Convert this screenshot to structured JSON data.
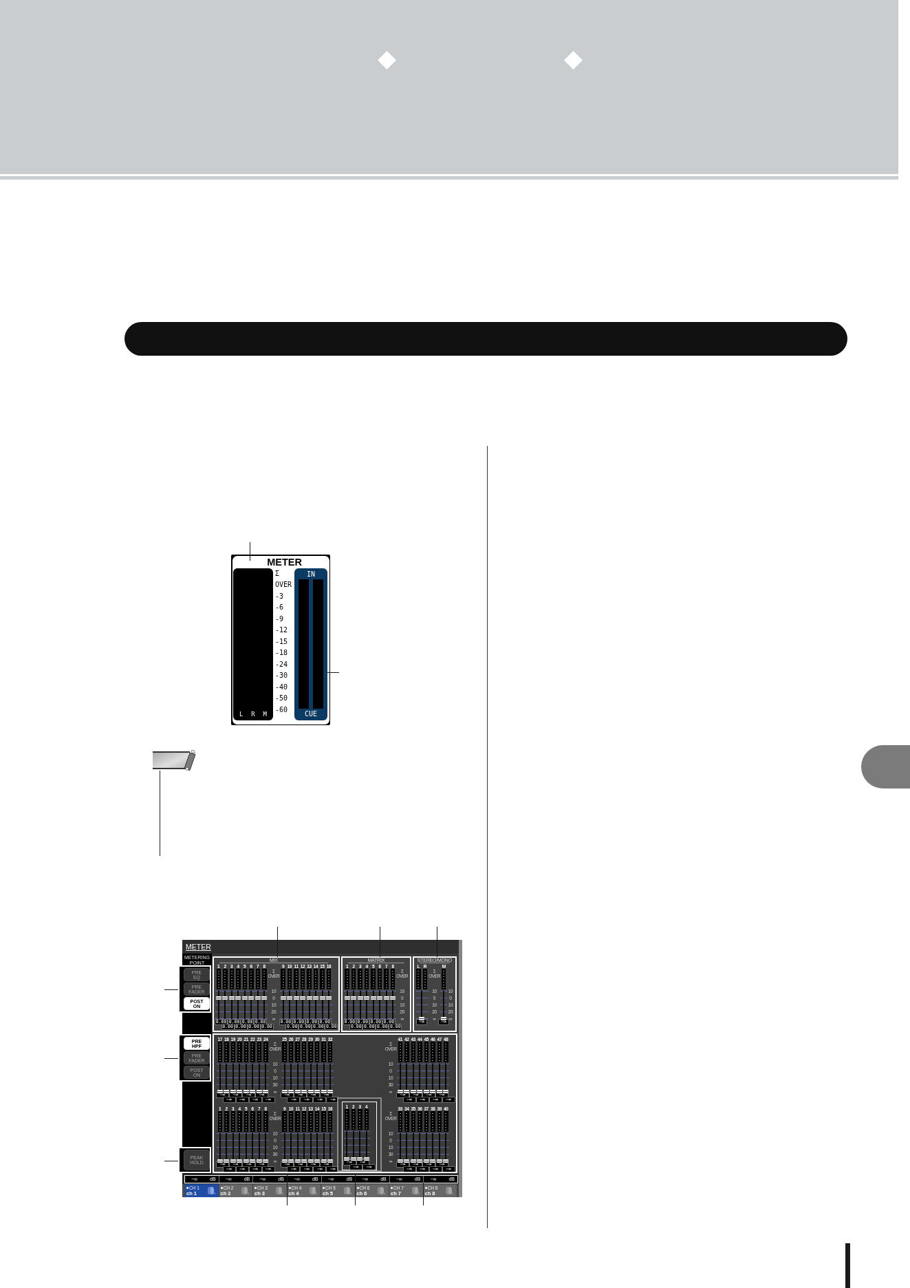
{
  "meter_panel": {
    "title": "METER",
    "channels": [
      "L",
      "R",
      "M"
    ],
    "scale": [
      "Σ",
      "OVER",
      "-3",
      "-6",
      "-9",
      "-12",
      "-15",
      "-18",
      "-24",
      "-30",
      "-40",
      "-50",
      "-60"
    ],
    "in_label": "IN",
    "cue_label": "CUE"
  },
  "meter_screen": {
    "title": "METER",
    "metering_point": "METERING POINT",
    "point_groups": [
      {
        "buttons": [
          {
            "label": "PRE EQ",
            "selected": false
          },
          {
            "label": "PRE FADER",
            "selected": false
          },
          {
            "label": "POST ON",
            "selected": true
          }
        ]
      },
      {
        "buttons": [
          {
            "label": "PRE HPF",
            "selected": true
          },
          {
            "label": "PRE FADER",
            "selected": false
          },
          {
            "label": "POST ON",
            "selected": false
          }
        ]
      },
      {
        "buttons": [
          {
            "label": "PEAK HOLD",
            "selected": false
          }
        ]
      }
    ],
    "sections": [
      {
        "title": "MIX",
        "items": [
          {
            "kind": "bank",
            "meters": [
              "1",
              "2",
              "3",
              "4",
              "5",
              "6",
              "7",
              "8"
            ],
            "faders": [
              {
                "level": 0.75,
                "readout": "0.00"
              },
              {
                "level": 0.75,
                "readout": "0.00"
              },
              {
                "level": 0.75,
                "readout": "0.00"
              },
              {
                "level": 0.75,
                "readout": "0.00"
              },
              {
                "level": 0.75,
                "readout": "0.00"
              },
              {
                "level": 0.75,
                "readout": "0.00"
              },
              {
                "level": 0.75,
                "readout": "0.00"
              },
              {
                "level": 0.75,
                "readout": "0.00"
              }
            ]
          },
          {
            "kind": "legend",
            "over": "Σ OVER",
            "scale": [
              "10",
              "0",
              "10",
              "20",
              "∞"
            ]
          },
          {
            "kind": "bank",
            "meters": [
              "9",
              "10",
              "11",
              "12",
              "13",
              "14",
              "15",
              "16"
            ],
            "faders": [
              {
                "level": 0.75,
                "readout": "0.00"
              },
              {
                "level": 0.75,
                "readout": "0.00"
              },
              {
                "level": 0.75,
                "readout": "0.00"
              },
              {
                "level": 0.75,
                "readout": "0.00"
              },
              {
                "level": 0.75,
                "readout": "0.00"
              },
              {
                "level": 0.75,
                "readout": "0.00"
              },
              {
                "level": 0.75,
                "readout": "0.00"
              },
              {
                "level": 0.75,
                "readout": "0.00"
              }
            ]
          }
        ]
      },
      {
        "title": "MATRIX",
        "items": [
          {
            "kind": "bank",
            "meters": [
              "1",
              "2",
              "3",
              "4",
              "5",
              "6",
              "7",
              "8"
            ],
            "faders": [
              {
                "level": 0.75,
                "readout": "0.00"
              },
              {
                "level": 0.75,
                "readout": "0.00"
              },
              {
                "level": 0.75,
                "readout": "0.00"
              },
              {
                "level": 0.75,
                "readout": "0.00"
              },
              {
                "level": 0.75,
                "readout": "0.00"
              },
              {
                "level": 0.75,
                "readout": "0.00"
              },
              {
                "level": 0.75,
                "readout": "0.00"
              },
              {
                "level": 0.75,
                "readout": "0.00"
              }
            ]
          },
          {
            "kind": "legend",
            "over": "Σ OVER",
            "scale": [
              "10",
              "0",
              "10",
              "20",
              "∞"
            ]
          }
        ]
      },
      {
        "title": "STEREO/MONO",
        "items": [
          {
            "kind": "bank",
            "meters": [
              "L",
              "R"
            ],
            "faders": [
              {
                "level": 0,
                "readout": "−∞"
              }
            ]
          },
          {
            "kind": "legend",
            "over": "Σ OVER",
            "scale": [
              "10",
              "0",
              "10",
              "20",
              "∞"
            ]
          },
          {
            "kind": "bank",
            "meters": [
              "M"
            ],
            "faders": [
              {
                "level": 0,
                "readout": "−∞"
              }
            ]
          },
          {
            "kind": "legend",
            "scale": [
              "10",
              "0",
              "10",
              "20",
              "∞"
            ]
          }
        ]
      }
    ],
    "lower_panel": {
      "rows": [
        {
          "groups": [
            {
              "kind": "plain",
              "items": [
                {
                  "kind": "bank",
                  "meters": [
                    "17",
                    "18",
                    "19",
                    "20",
                    "21",
                    "22",
                    "23",
                    "24"
                  ],
                  "faders": [
                    {
                      "level": 0,
                      "readout": "−∞"
                    },
                    {
                      "level": 0,
                      "readout": "−∞"
                    },
                    {
                      "level": 0,
                      "readout": "−∞"
                    },
                    {
                      "level": 0,
                      "readout": "−∞"
                    },
                    {
                      "level": 0,
                      "readout": "−∞"
                    },
                    {
                      "level": 0,
                      "readout": "−∞"
                    },
                    {
                      "level": 0,
                      "readout": "−∞"
                    },
                    {
                      "level": 0,
                      "readout": "−∞"
                    }
                  ]
                },
                {
                  "kind": "legend",
                  "over": "Σ OVER",
                  "scale": [
                    "10",
                    "0",
                    "10",
                    "30",
                    "∞"
                  ]
                },
                {
                  "kind": "bank",
                  "meters": [
                    "25",
                    "26",
                    "27",
                    "28",
                    "29",
                    "30",
                    "31",
                    "32"
                  ],
                  "faders": [
                    {
                      "level": 0,
                      "readout": "−∞"
                    },
                    {
                      "level": 0,
                      "readout": "−∞"
                    },
                    {
                      "level": 0,
                      "readout": "−∞"
                    },
                    {
                      "level": 0,
                      "readout": "−∞"
                    },
                    {
                      "level": 0,
                      "readout": "−∞"
                    },
                    {
                      "level": 0,
                      "readout": "−∞"
                    },
                    {
                      "level": 0,
                      "readout": "−∞"
                    },
                    {
                      "level": 0,
                      "readout": "−∞"
                    }
                  ]
                }
              ]
            },
            {
              "kind": "plain",
              "items": [
                {
                  "kind": "legend",
                  "over": "Σ OVER",
                  "scale": [
                    "10",
                    "0",
                    "10",
                    "30",
                    "∞"
                  ]
                },
                {
                  "kind": "bank",
                  "meters": [
                    "41",
                    "42",
                    "43",
                    "44",
                    "45",
                    "46",
                    "47",
                    "48"
                  ],
                  "faders": [
                    {
                      "level": 0,
                      "readout": "−∞"
                    },
                    {
                      "level": 0,
                      "readout": "−∞"
                    },
                    {
                      "level": 0,
                      "readout": "−∞"
                    },
                    {
                      "level": 0,
                      "readout": "−∞"
                    },
                    {
                      "level": 0,
                      "readout": "−∞"
                    },
                    {
                      "level": 0,
                      "readout": "−∞"
                    },
                    {
                      "level": 0,
                      "readout": "−∞"
                    },
                    {
                      "level": 0,
                      "readout": "−∞"
                    }
                  ]
                }
              ]
            }
          ]
        },
        {
          "groups": [
            {
              "kind": "plain",
              "items": [
                {
                  "kind": "bank",
                  "meters": [
                    "1",
                    "2",
                    "3",
                    "4",
                    "5",
                    "6",
                    "7",
                    "8"
                  ],
                  "faders": [
                    {
                      "level": 0,
                      "readout": "−∞"
                    },
                    {
                      "level": 0,
                      "readout": "−∞"
                    },
                    {
                      "level": 0,
                      "readout": "−∞"
                    },
                    {
                      "level": 0,
                      "readout": "−∞"
                    },
                    {
                      "level": 0,
                      "readout": "−∞"
                    },
                    {
                      "level": 0,
                      "readout": "−∞"
                    },
                    {
                      "level": 0,
                      "readout": "−∞"
                    },
                    {
                      "level": 0,
                      "readout": "−∞"
                    }
                  ]
                },
                {
                  "kind": "legend",
                  "over": "Σ OVER",
                  "scale": [
                    "10",
                    "0",
                    "10",
                    "30",
                    "∞"
                  ]
                },
                {
                  "kind": "bank",
                  "meters": [
                    "9",
                    "10",
                    "11",
                    "12",
                    "13",
                    "14",
                    "15",
                    "16"
                  ],
                  "faders": [
                    {
                      "level": 0,
                      "readout": "−∞"
                    },
                    {
                      "level": 0,
                      "readout": "−∞"
                    },
                    {
                      "level": 0,
                      "readout": "−∞"
                    },
                    {
                      "level": 0,
                      "readout": "−∞"
                    },
                    {
                      "level": 0,
                      "readout": "−∞"
                    },
                    {
                      "level": 0,
                      "readout": "−∞"
                    },
                    {
                      "level": 0,
                      "readout": "−∞"
                    },
                    {
                      "level": 0,
                      "readout": "−∞"
                    }
                  ]
                }
              ]
            },
            {
              "kind": "boxed",
              "items": [
                {
                  "kind": "bank",
                  "meters": [
                    "1",
                    "2",
                    "3",
                    "4"
                  ],
                  "faders": [
                    {
                      "level": 0,
                      "readout": "−∞"
                    },
                    {
                      "level": 0,
                      "readout": "−∞"
                    },
                    {
                      "level": 0,
                      "readout": "−∞"
                    },
                    {
                      "level": 0,
                      "readout": "−∞"
                    }
                  ]
                }
              ]
            },
            {
              "kind": "plain",
              "items": [
                {
                  "kind": "legend",
                  "over": "Σ OVER",
                  "scale": [
                    "10",
                    "0",
                    "10",
                    "30",
                    "∞"
                  ]
                },
                {
                  "kind": "bank",
                  "meters": [
                    "33",
                    "34",
                    "35",
                    "36",
                    "37",
                    "38",
                    "39",
                    "40"
                  ],
                  "faders": [
                    {
                      "level": 0,
                      "readout": "−∞"
                    },
                    {
                      "level": 0,
                      "readout": "−∞"
                    },
                    {
                      "level": 0,
                      "readout": "−∞"
                    },
                    {
                      "level": 0,
                      "readout": "−∞"
                    },
                    {
                      "level": 0,
                      "readout": "−∞"
                    },
                    {
                      "level": 0,
                      "readout": "−∞"
                    },
                    {
                      "level": 0,
                      "readout": "−∞"
                    },
                    {
                      "level": 0,
                      "readout": "−∞"
                    }
                  ]
                }
              ]
            }
          ]
        }
      ]
    },
    "outputs": [
      {
        "value": "−∞",
        "unit": "dB"
      },
      {
        "value": "−∞",
        "unit": "dB"
      },
      {
        "value": "−∞",
        "unit": "dB"
      },
      {
        "value": "−∞",
        "unit": "dB"
      },
      {
        "value": "−∞",
        "unit": "dB"
      },
      {
        "value": "−∞",
        "unit": "dB"
      },
      {
        "value": "−∞",
        "unit": "dB"
      },
      {
        "value": "−∞",
        "unit": "dB"
      }
    ],
    "channels": [
      {
        "number": "CH 1",
        "name": "ch 1",
        "selected": true
      },
      {
        "number": "CH 2",
        "name": "ch 2",
        "selected": false
      },
      {
        "number": "CH 3",
        "name": "ch 3",
        "selected": false
      },
      {
        "number": "CH 4",
        "name": "ch 4",
        "selected": false
      },
      {
        "number": "CH 5",
        "name": "ch 5",
        "selected": false
      },
      {
        "number": "CH 6",
        "name": "ch 6",
        "selected": false
      },
      {
        "number": "CH 7",
        "name": "ch 7",
        "selected": false
      },
      {
        "number": "CH 8",
        "name": "ch 8",
        "selected": false
      }
    ]
  }
}
